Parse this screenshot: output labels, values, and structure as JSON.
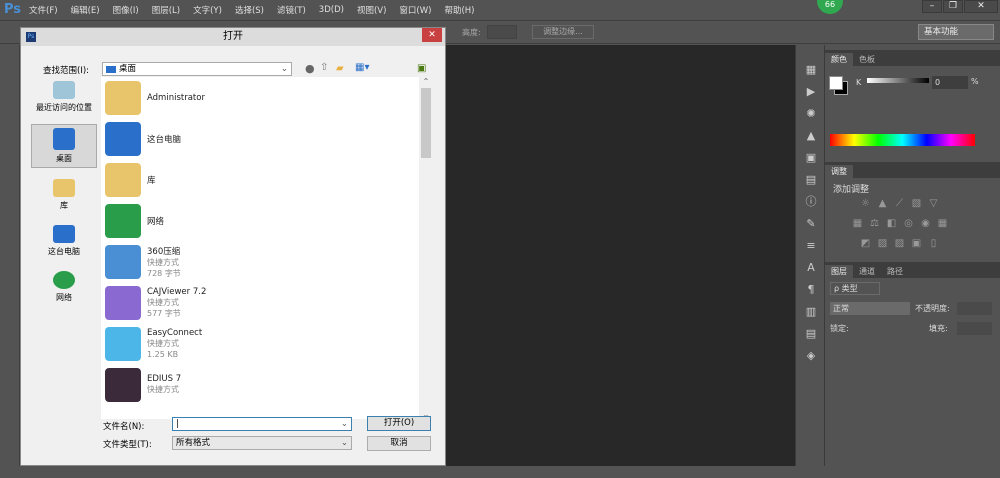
{
  "app": {
    "logo": "Ps",
    "menus": [
      "文件(F)",
      "编辑(E)",
      "图像(I)",
      "图层(L)",
      "文字(Y)",
      "选择(S)",
      "滤镜(T)",
      "3D(D)",
      "视图(V)",
      "窗口(W)",
      "帮助(H)"
    ],
    "badge": "66"
  },
  "options": {
    "height_label": "高度:",
    "refine_edge": "调整边缘...",
    "workspace": "基本功能"
  },
  "dialog": {
    "title": "打开",
    "lookin_label": "查找范围(I):",
    "lookin_value": "桌面",
    "places": [
      "最近访问的位置",
      "桌面",
      "库",
      "这台电脑",
      "网络"
    ],
    "files": [
      {
        "name": "Administrator",
        "type": "",
        "size": "",
        "icon": "user-folder",
        "color": "#e8c46a"
      },
      {
        "name": "这台电脑",
        "type": "",
        "size": "",
        "icon": "computer",
        "color": "#2a6fc9"
      },
      {
        "name": "库",
        "type": "",
        "size": "",
        "icon": "library",
        "color": "#e8c46a"
      },
      {
        "name": "网络",
        "type": "",
        "size": "",
        "icon": "network",
        "color": "#2a9d4a"
      },
      {
        "name": "360压缩",
        "type": "快捷方式",
        "size": "728 字节",
        "icon": "archive",
        "color": "#4a8fd4"
      },
      {
        "name": "CAJViewer 7.2",
        "type": "快捷方式",
        "size": "577 字节",
        "icon": "cajviewer",
        "color": "#8a6ad0"
      },
      {
        "name": "EasyConnect",
        "type": "快捷方式",
        "size": "1.25 KB",
        "icon": "easyconnect",
        "color": "#4db6e8"
      },
      {
        "name": "EDIUS 7",
        "type": "快捷方式",
        "size": "",
        "icon": "edius",
        "color": "#3a2a3a"
      }
    ],
    "filename_label": "文件名(N):",
    "filename_value": "",
    "filetype_label": "文件类型(T):",
    "filetype_value": "所有格式",
    "open_button": "打开(O)",
    "cancel_button": "取消"
  },
  "panels": {
    "color_tabs": [
      "颜色",
      "色板"
    ],
    "k_label": "K",
    "k_value": "0",
    "percent": "%",
    "adjust_tab": "调整",
    "adjust_title": "添加调整",
    "layers_tabs": [
      "图层",
      "通道",
      "路径"
    ],
    "kind": "ρ 类型",
    "blend": "正常",
    "opacity_label": "不透明度:",
    "lock_label": "锁定:",
    "fill_label": "填充:"
  }
}
